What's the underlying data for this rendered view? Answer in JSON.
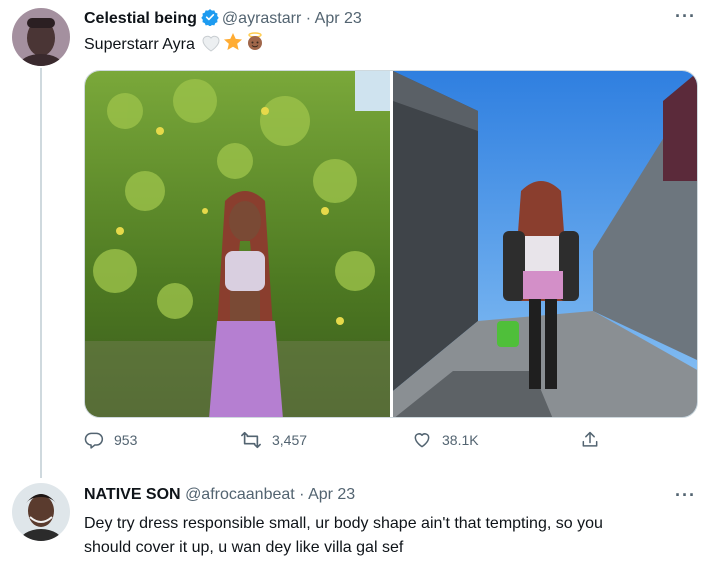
{
  "tweet": {
    "author_name": "Celestial being",
    "handle": "@ayrastarr",
    "separator": "·",
    "time": "Apr 23",
    "text": "Superstarr Ayra",
    "emojis": [
      "white-heart-icon",
      "star-icon",
      "angel-icon"
    ],
    "more_label": "···",
    "stats": {
      "replies": "953",
      "retweets": "3,457",
      "likes": "38.1K"
    }
  },
  "reply": {
    "author_name": "NATIVE SON",
    "handle": "@afrocaanbeat",
    "separator": "·",
    "time": "Apr 23",
    "text_line1": "Dey try dress responsible small, ur body shape ain't that tempting, so you",
    "text_line2": "should cover it up, u wan dey like villa gal sef",
    "more_label": "···"
  },
  "colors": {
    "verified": "#1d9bf0",
    "muted": "#536471",
    "text": "#0f1419",
    "divider": "#cfd9de"
  }
}
